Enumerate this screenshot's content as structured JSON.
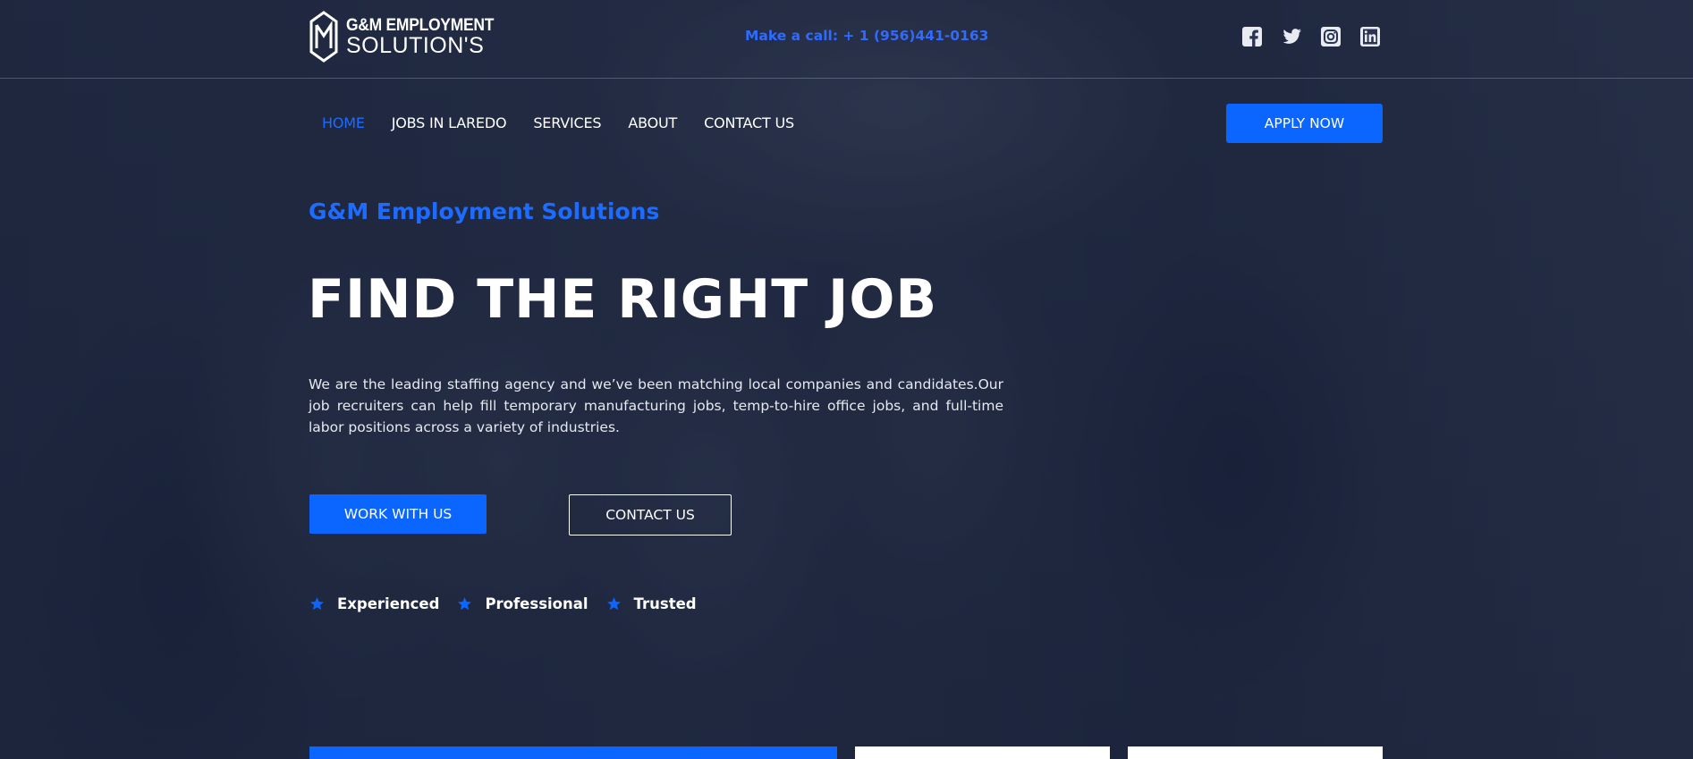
{
  "brand": {
    "logo_line1": "G&M EMPLOYMENT",
    "logo_line2": "SOLUTION'S",
    "accent_color": "#0a66ff"
  },
  "header": {
    "phone": "Make a call: + 1 (956)441-0163",
    "socials": [
      "facebook-icon",
      "twitter-icon",
      "instagram-icon",
      "linkedin-icon"
    ]
  },
  "nav": {
    "items": [
      {
        "label": "HOME",
        "active": true
      },
      {
        "label": "JOBS IN LAREDO"
      },
      {
        "label": "SERVICES"
      },
      {
        "label": "ABOUT"
      },
      {
        "label": "CONTACT US"
      }
    ],
    "apply_label": "APPLY NOW"
  },
  "hero": {
    "subtitle": "G&M Employment Solutions",
    "headline": "FIND THE RIGHT JOB",
    "description": "We are the leading staffing agency and we’ve been matching local companies and candidates.Our job recruiters can help fill temporary manufacturing jobs, temp-to-hire office jobs, and full-time labor positions across a variety of industries.",
    "primary_button": "WORK WITH US",
    "secondary_button": "CONTACT US",
    "badges": [
      "Experienced",
      "Professional",
      "Trusted"
    ]
  }
}
